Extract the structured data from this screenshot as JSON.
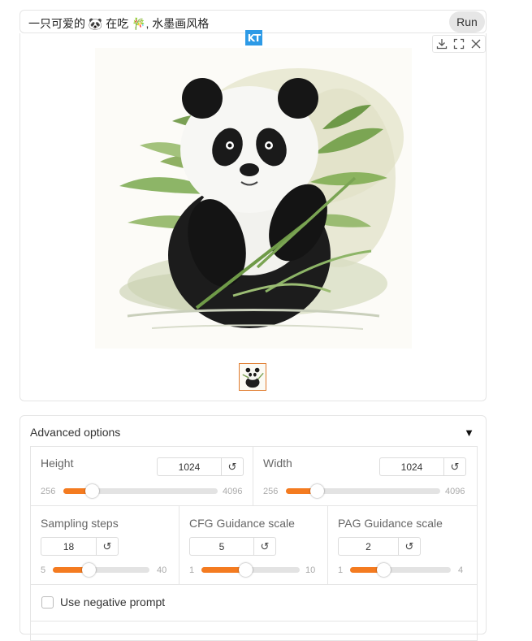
{
  "prompt": {
    "text": "一只可爱的 🐼 在吃 🎋, 水墨画风格",
    "run_label": "Run"
  },
  "badge": {
    "text": "KT"
  },
  "gallery": {
    "toolbar": [
      "download-icon",
      "fullscreen-icon",
      "close-icon"
    ],
    "main_image": "panda-eating-bamboo-ink-painting",
    "thumbnail": "panda-thumbnail"
  },
  "advanced": {
    "title": "Advanced options",
    "toggle_icon": "triangle-down-icon",
    "accent_color": "#f47b20",
    "height": {
      "label": "Height",
      "value": "1024",
      "min": "256",
      "max": "4096",
      "fraction": 0.183
    },
    "width": {
      "label": "Width",
      "value": "1024",
      "min": "256",
      "max": "4096",
      "fraction": 0.2
    },
    "steps": {
      "label": "Sampling steps",
      "value": "18",
      "min": "5",
      "max": "40",
      "fraction": 0.37
    },
    "cfg": {
      "label": "CFG Guidance scale",
      "value": "5",
      "min": "1",
      "max": "10",
      "fraction": 0.444
    },
    "pag": {
      "label": "PAG Guidance scale",
      "value": "2",
      "min": "1",
      "max": "4",
      "fraction": 0.333
    },
    "negative": {
      "label": "Use negative prompt",
      "checked": false
    },
    "reset_icon": "↺"
  }
}
